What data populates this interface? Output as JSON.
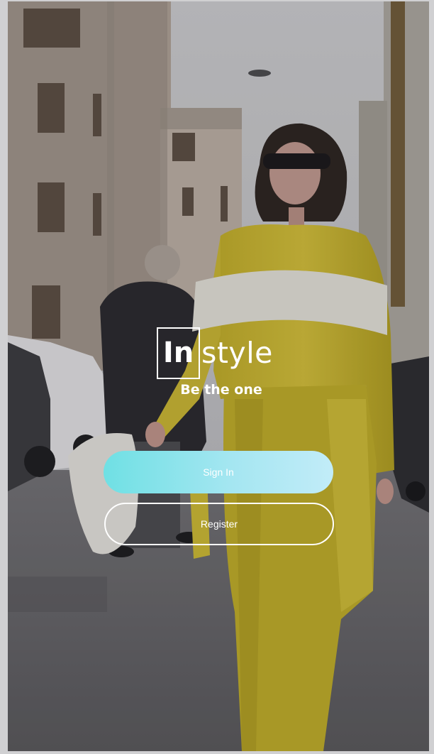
{
  "brand": {
    "logo_boxed": "In",
    "logo_rest": "style",
    "tagline": "Be the one"
  },
  "actions": {
    "sign_in_label": "Sign In",
    "register_label": "Register"
  },
  "colors": {
    "sign_in_gradient_start": "#6fe0e4",
    "sign_in_gradient_end": "#c2ecf8",
    "text": "#ffffff"
  }
}
